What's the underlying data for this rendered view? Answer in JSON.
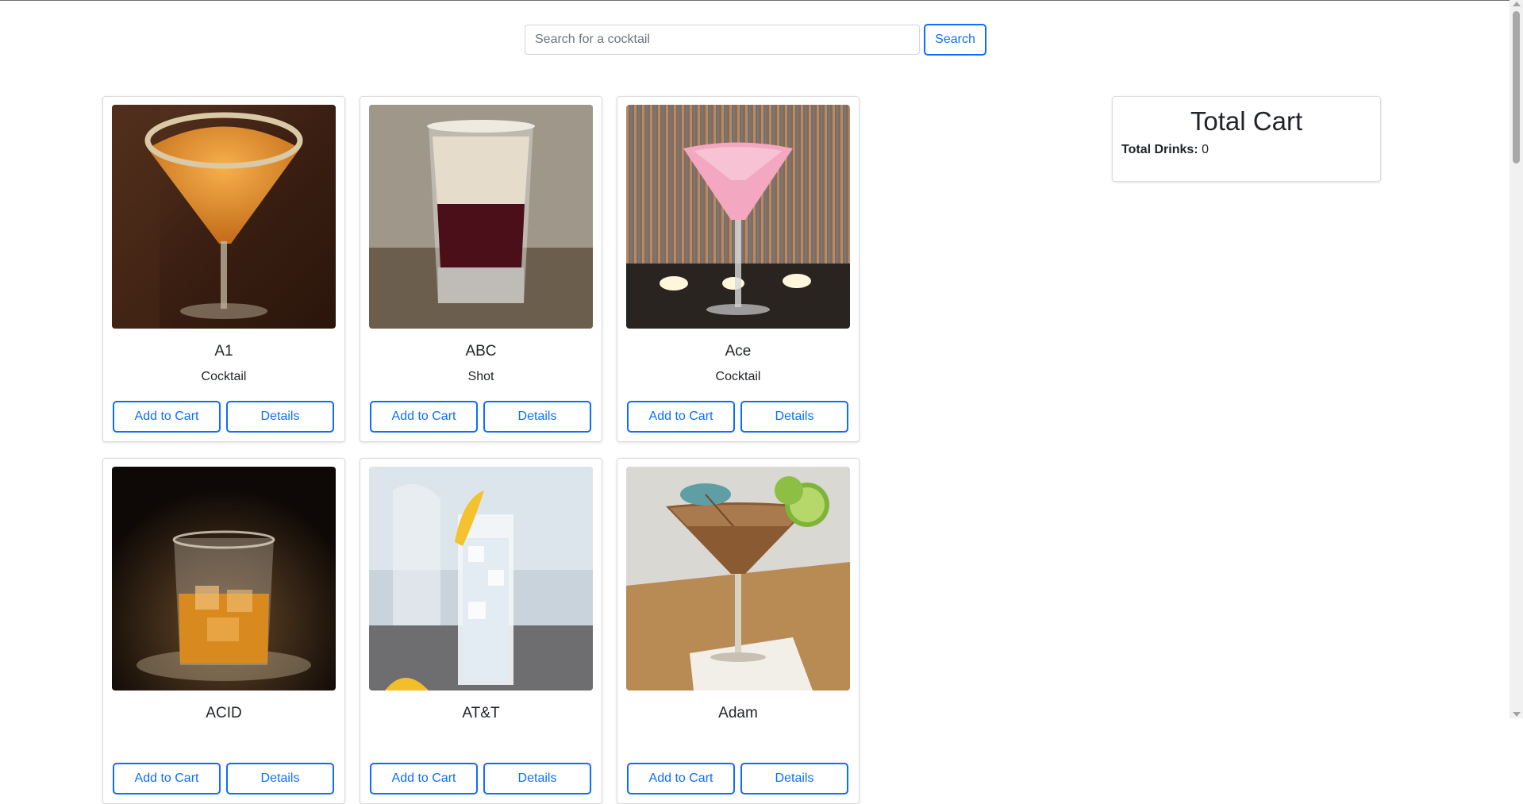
{
  "search": {
    "placeholder": "Search for a cocktail",
    "value": "",
    "button_label": "Search"
  },
  "drinks": [
    {
      "name": "A1",
      "category": "Cocktail",
      "add_label": "Add to Cart",
      "details_label": "Details"
    },
    {
      "name": "ABC",
      "category": "Shot",
      "add_label": "Add to Cart",
      "details_label": "Details"
    },
    {
      "name": "Ace",
      "category": "Cocktail",
      "add_label": "Add to Cart",
      "details_label": "Details"
    },
    {
      "name": "ACID",
      "category": "",
      "add_label": "Add to Cart",
      "details_label": "Details"
    },
    {
      "name": "AT&T",
      "category": "",
      "add_label": "Add to Cart",
      "details_label": "Details"
    },
    {
      "name": "Adam",
      "category": "",
      "add_label": "Add to Cart",
      "details_label": "Details"
    }
  ],
  "cart": {
    "title": "Total Cart",
    "total_label": "Total Drinks:",
    "total_value": "0"
  },
  "colors": {
    "accent": "#0d6efd",
    "text": "#212529",
    "border": "#dcdcdc"
  }
}
